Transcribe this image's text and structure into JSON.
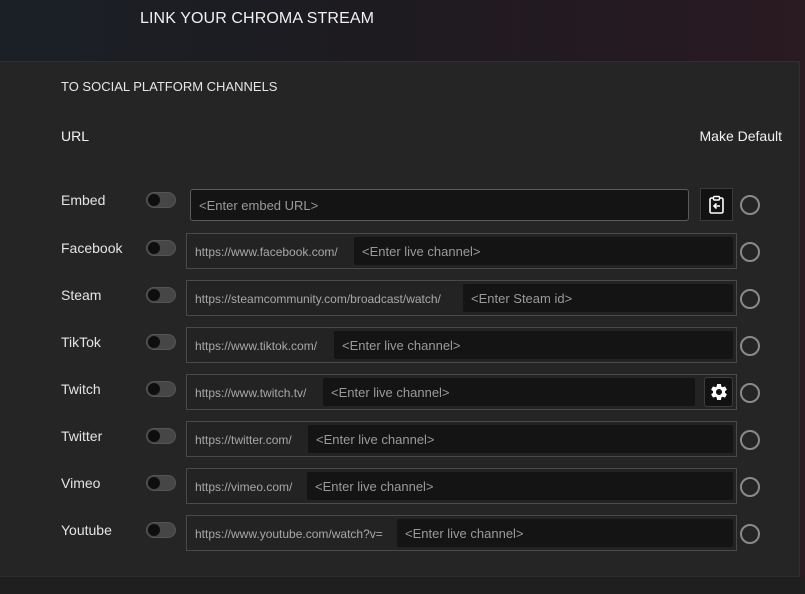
{
  "header": {
    "title": "LINK YOUR CHROMA STREAM"
  },
  "panel": {
    "subtitle": "TO SOCIAL PLATFORM CHANNELS",
    "url_label": "URL",
    "default_label": "Make Default"
  },
  "rows": {
    "embed": {
      "label": "Embed",
      "placeholder": "<Enter embed URL>",
      "enabled": false,
      "is_default": false,
      "action_icon": "paste-clipboard-icon"
    },
    "facebook": {
      "label": "Facebook",
      "prefix": "https://www.facebook.com/",
      "placeholder": "<Enter live channel>",
      "enabled": false,
      "is_default": false
    },
    "steam": {
      "label": "Steam",
      "prefix": "https://steamcommunity.com/broadcast/watch/",
      "placeholder": "<Enter Steam id>",
      "enabled": false,
      "is_default": false
    },
    "tiktok": {
      "label": "TikTok",
      "prefix": "https://www.tiktok.com/",
      "placeholder": "<Enter live channel>",
      "enabled": false,
      "is_default": false
    },
    "twitch": {
      "label": "Twitch",
      "prefix": "https://www.twitch.tv/",
      "placeholder": "<Enter live channel>",
      "enabled": false,
      "is_default": false,
      "action_icon": "gear-icon"
    },
    "twitter": {
      "label": "Twitter",
      "prefix": "https://twitter.com/",
      "placeholder": "<Enter live channel>",
      "enabled": false,
      "is_default": false
    },
    "vimeo": {
      "label": "Vimeo",
      "prefix": "https://vimeo.com/",
      "placeholder": "<Enter live channel>",
      "enabled": false,
      "is_default": false
    },
    "youtube": {
      "label": "Youtube",
      "prefix": "https://www.youtube.com/watch?v=",
      "placeholder": "<Enter live channel>",
      "enabled": false,
      "is_default": false
    }
  }
}
